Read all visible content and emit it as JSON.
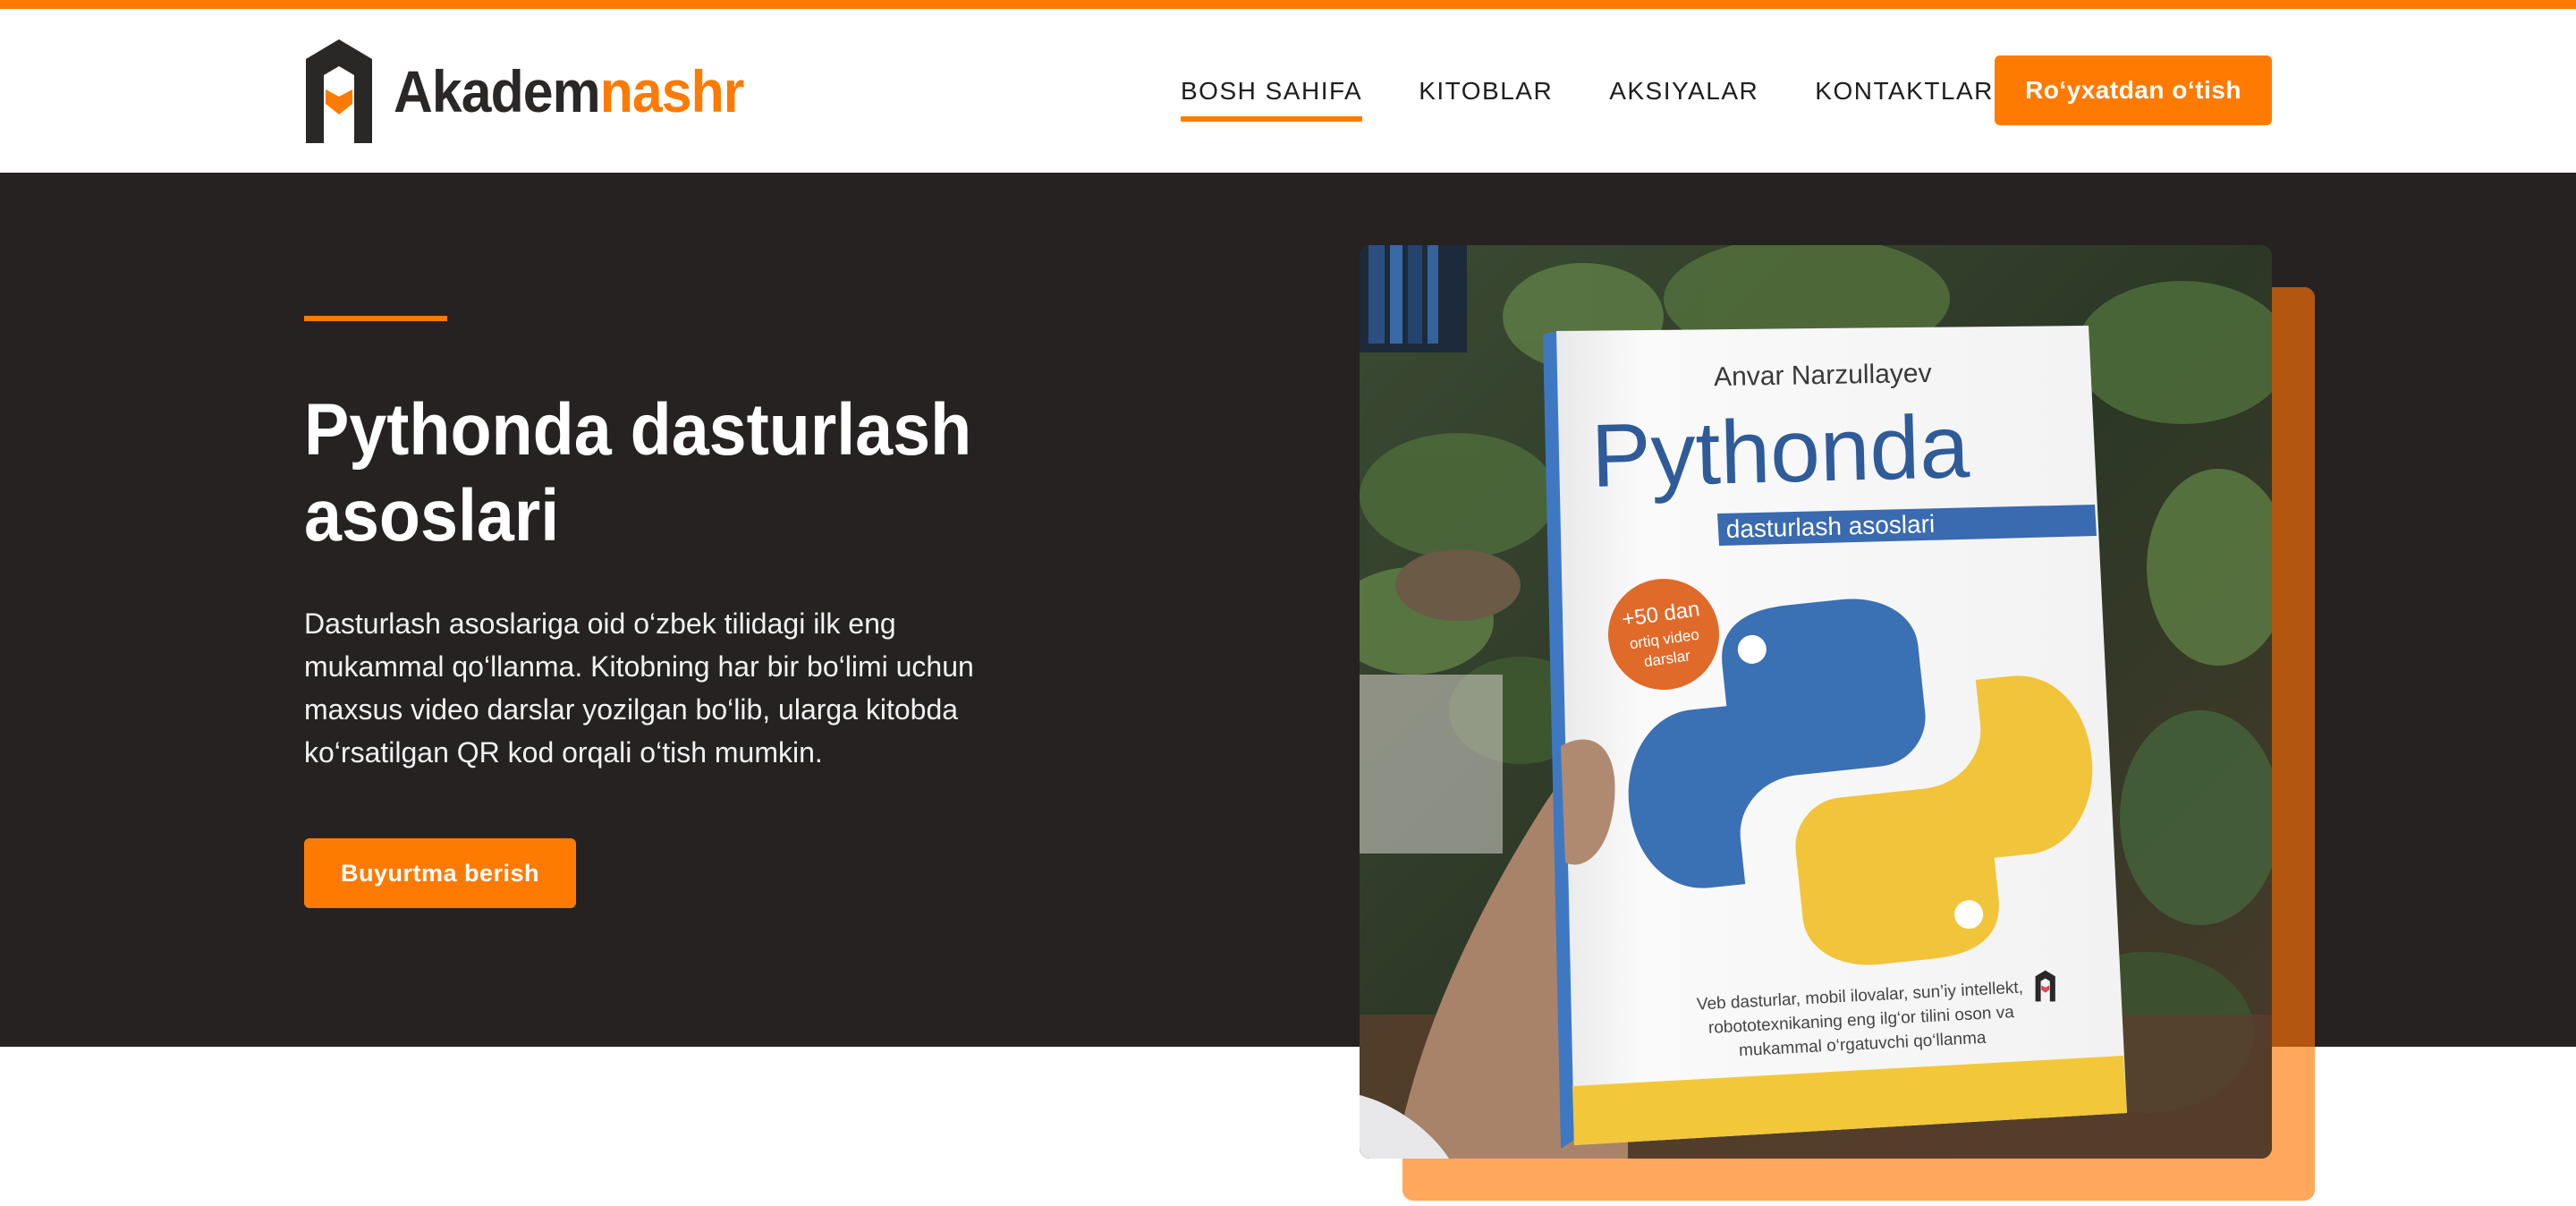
{
  "header": {
    "logo": {
      "brand_dark": "Akadem",
      "brand_orange": "nashr",
      "icon": "logo-icon"
    },
    "nav": [
      {
        "label": "BOSH SAHIFA",
        "active": true
      },
      {
        "label": "KITOBLAR",
        "active": false
      },
      {
        "label": "AKSIYALAR",
        "active": false
      },
      {
        "label": "KONTAKTLAR",
        "active": false
      }
    ],
    "register_button": "Ro‘yxatdan o‘tish"
  },
  "hero": {
    "title": "Pythonda dasturlash asoslari",
    "description": "Dasturlash asoslariga oid o‘zbek tilidagi ilk eng mukammal qo‘llanma. Kitobning har bir bo‘limi uchun maxsus video darslar yozilgan bo‘lib, ularga kitobda ko‘rsatilgan QR kod orqali o‘tish mumkin.",
    "order_button": "Buyurtma berish"
  },
  "book_cover": {
    "author": "Anvar Narzullayev",
    "title": "Pythonda",
    "subtitle": "dasturlash asoslari",
    "badge_line1": "+50 dan",
    "badge_line2": "ortiq video",
    "badge_line3": "darslar",
    "footer_line1": "Veb dasturlar, mobil ilovalar, sun’iy intellekt,",
    "footer_line2": "robototexnikaning eng ilg‘or tilini oson va",
    "footer_line3": "mukammal o‘rgatuvchi qo‘llanma"
  },
  "colors": {
    "accent": "#ff7a00",
    "hero_bg": "#262222",
    "shadow_dark": "#b25610",
    "shadow_light": "#ffa75c",
    "python_blue": "#3a6fb0",
    "python_yellow": "#f2c43a"
  }
}
